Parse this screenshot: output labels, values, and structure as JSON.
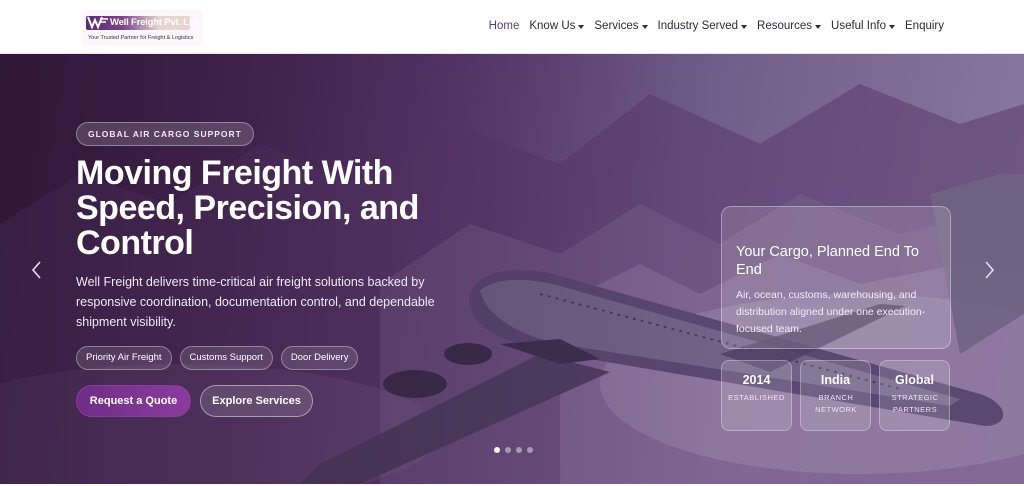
{
  "brand": {
    "name": "Well Freight Pvt. Ltd.",
    "tagline": "Your Trusted Partner for Freight & Logistics",
    "colors": {
      "primary": "#6f2d86",
      "text": "#2d2a3a",
      "active": "#5b3a8a"
    }
  },
  "nav": {
    "items": [
      {
        "label": "Home",
        "dropdown": false,
        "active": true
      },
      {
        "label": "Know Us",
        "dropdown": true,
        "active": false
      },
      {
        "label": "Services",
        "dropdown": true,
        "active": false
      },
      {
        "label": "Industry Served",
        "dropdown": true,
        "active": false
      },
      {
        "label": "Resources",
        "dropdown": true,
        "active": false
      },
      {
        "label": "Useful Info",
        "dropdown": true,
        "active": false
      },
      {
        "label": "Enquiry",
        "dropdown": false,
        "active": false
      }
    ]
  },
  "hero": {
    "eyebrow": "GLOBAL AIR CARGO SUPPORT",
    "headline_lines": [
      "Moving Freight With",
      "Speed, Precision, and",
      "Control"
    ],
    "description": "Well Freight delivers time-critical air freight solutions backed by responsive coordination, documentation control, and dependable shipment visibility.",
    "chips": [
      "Priority Air Freight",
      "Customs Support",
      "Door Delivery"
    ],
    "primary_button": "Request a Quote",
    "secondary_button": "Explore Services",
    "prev_icon": "chevron-left-icon",
    "next_icon": "chevron-right-icon"
  },
  "card": {
    "title": "Your Cargo, Planned End To End",
    "text": "Air, ocean, customs, warehousing, and distribution aligned under one execution-focused team."
  },
  "stats": [
    {
      "value": "2014",
      "label": "ESTABLISHED"
    },
    {
      "value": "India",
      "label": "BRANCH NETWORK"
    },
    {
      "value": "Global",
      "label": "STRATEGIC PARTNERS"
    }
  ],
  "slider": {
    "slide_count": 4,
    "active_index": 0
  }
}
